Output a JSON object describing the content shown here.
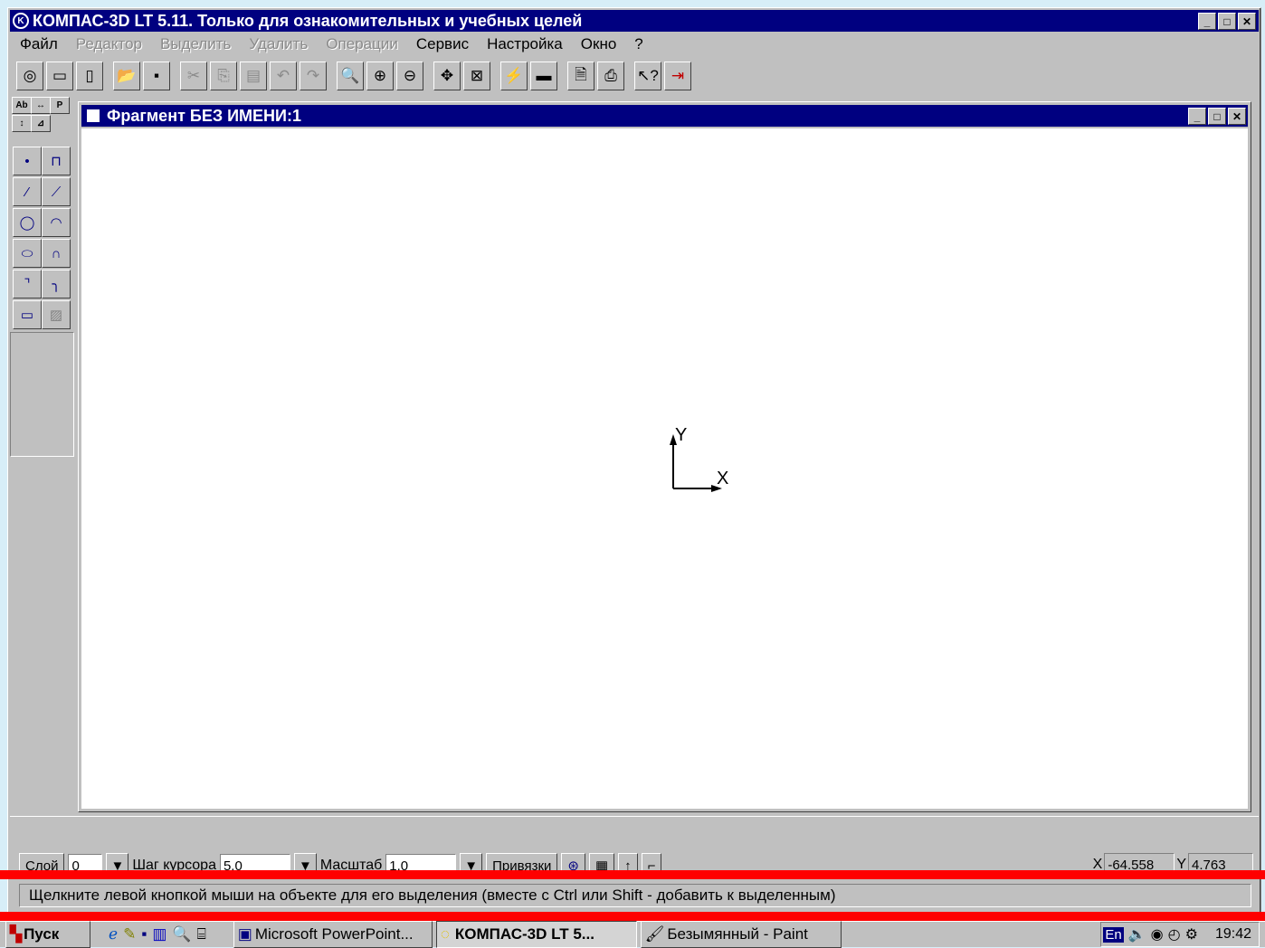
{
  "app": {
    "title": "КОМПАС-3D LT 5.11. Только для ознакомительных и учебных целей",
    "logo_icon": "kompas-logo-icon"
  },
  "menu": [
    {
      "label": "Файл",
      "enabled": true
    },
    {
      "label": "Редактор",
      "enabled": false
    },
    {
      "label": "Выделить",
      "enabled": false
    },
    {
      "label": "Удалить",
      "enabled": false
    },
    {
      "label": "Операции",
      "enabled": false
    },
    {
      "label": "Сервис",
      "enabled": true
    },
    {
      "label": "Настройка",
      "enabled": true
    },
    {
      "label": "Окно",
      "enabled": true
    },
    {
      "label": "?",
      "enabled": true
    }
  ],
  "doc": {
    "title": "Фрагмент БЕЗ ИМЕНИ:1",
    "axis_y": "Y",
    "axis_x": "X"
  },
  "status": {
    "layer_label": "Слой",
    "layer_value": "0",
    "step_label": "Шаг курсора",
    "step_value": "5.0",
    "scale_label": "Масштаб",
    "scale_value": "1.0",
    "snaps_label": "Привязки",
    "x_label": "X",
    "x_value": "-64.558",
    "y_label": "Y",
    "y_value": "4.763",
    "hint": "Щелкните левой кнопкой мыши на объекте для его выделения (вместе с Ctrl или Shift - добавить к выделенным)"
  },
  "taskbar": {
    "start_label": "Пуск",
    "tasks": [
      {
        "label": "Microsoft PowerPoint...",
        "active": false
      },
      {
        "label": "КОМПАС-3D LT 5...",
        "active": true
      },
      {
        "label": "Безымянный - Paint",
        "active": false
      }
    ],
    "lang": "En",
    "clock": "19:42"
  },
  "colors": {
    "titlebar": "#000080",
    "chrome": "#c0c0c0",
    "highlight_line": "#ff0000"
  }
}
